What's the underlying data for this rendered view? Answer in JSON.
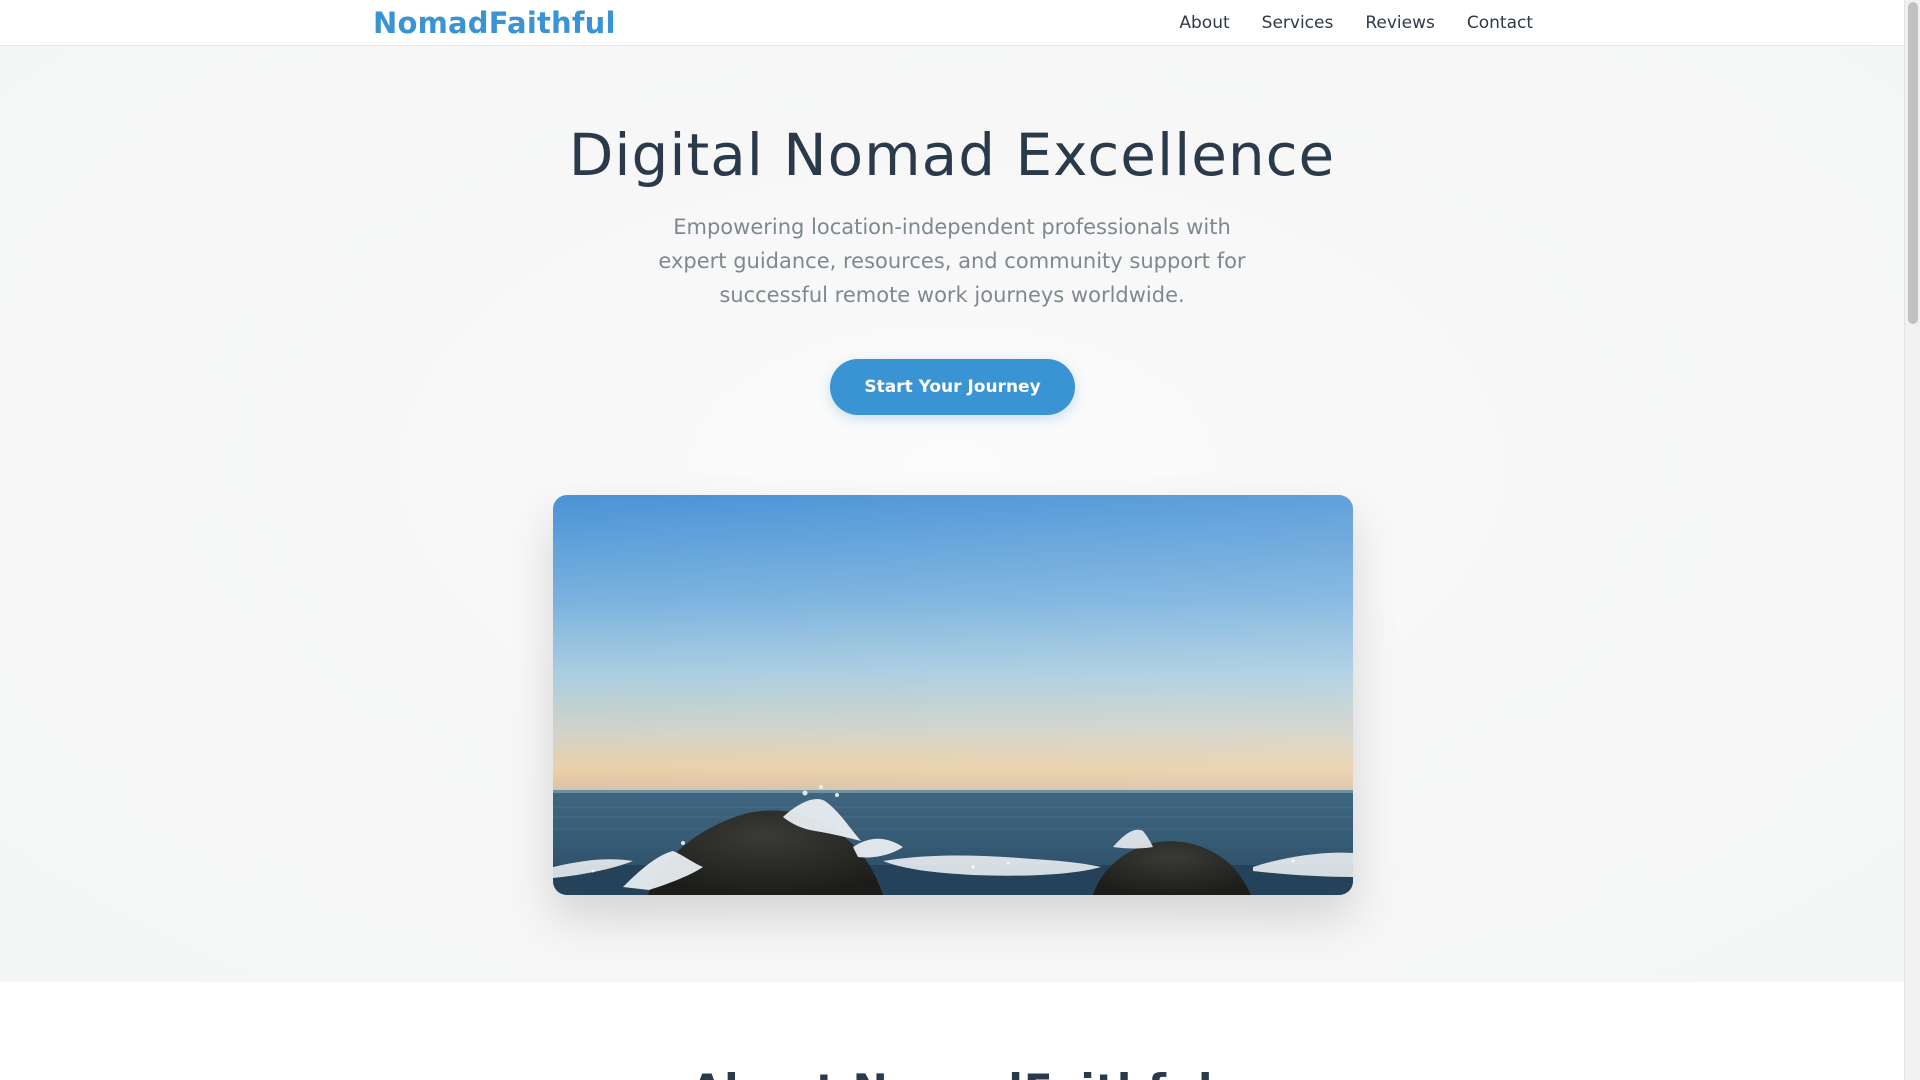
{
  "navbar": {
    "brand": "NomadFaithful",
    "links": [
      "About",
      "Services",
      "Reviews",
      "Contact"
    ]
  },
  "hero": {
    "title": "Digital Nomad Excellence",
    "subtitle": "Empowering location-independent professionals with expert guidance, resources, and community support for successful remote work journeys worldwide.",
    "cta_label": "Start Your Journey",
    "image_subject": "ocean-waves-rocks-sunset"
  },
  "about": {
    "heading": "About NomadFaithful"
  },
  "colors": {
    "accent": "#3a93d2",
    "title_text": "#2a3a4b",
    "muted_text": "#7c8a8f"
  }
}
